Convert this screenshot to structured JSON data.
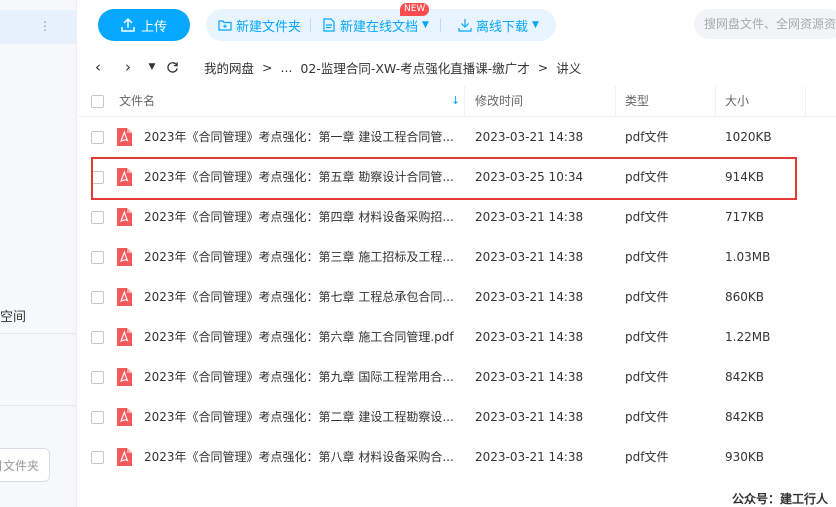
{
  "sidebar": {
    "space_label": "空间",
    "new_folder_label": "目文件夹"
  },
  "toolbar": {
    "upload_label": "上传",
    "new_folder_label": "新建文件夹",
    "new_online_doc_label": "新建在线文档",
    "new_badge": "NEW",
    "offline_download_label": "离线下载",
    "search_placeholder": "搜网盘文件、全网资源资"
  },
  "breadcrumb": {
    "items": [
      "我的网盘",
      "...",
      "02-监理合同-XW-考点强化直播课-缴广才",
      "讲义"
    ],
    "separator": ">"
  },
  "table": {
    "headers": {
      "name": "文件名",
      "modified": "修改时间",
      "type": "类型",
      "size": "大小"
    },
    "rows": [
      {
        "name": "2023年《合同管理》考点强化：第一章 建设工程合同管...",
        "modified": "2023-03-21 14:38",
        "type": "pdf文件",
        "size": "1020KB"
      },
      {
        "name": "2023年《合同管理》考点强化：第五章 勘察设计合同管...",
        "modified": "2023-03-25 10:34",
        "type": "pdf文件",
        "size": "914KB"
      },
      {
        "name": "2023年《合同管理》考点强化：第四章 材料设备采购招...",
        "modified": "2023-03-21 14:38",
        "type": "pdf文件",
        "size": "717KB"
      },
      {
        "name": "2023年《合同管理》考点强化：第三章 施工招标及工程...",
        "modified": "2023-03-21 14:38",
        "type": "pdf文件",
        "size": "1.03MB"
      },
      {
        "name": "2023年《合同管理》考点强化：第七章 工程总承包合同...",
        "modified": "2023-03-21 14:38",
        "type": "pdf文件",
        "size": "860KB"
      },
      {
        "name": "2023年《合同管理》考点强化：第六章 施工合同管理.pdf",
        "modified": "2023-03-21 14:38",
        "type": "pdf文件",
        "size": "1.22MB"
      },
      {
        "name": "2023年《合同管理》考点强化：第九章 国际工程常用合...",
        "modified": "2023-03-21 14:38",
        "type": "pdf文件",
        "size": "842KB"
      },
      {
        "name": "2023年《合同管理》考点强化：第二章 建设工程勘察设...",
        "modified": "2023-03-21 14:38",
        "type": "pdf文件",
        "size": "842KB"
      },
      {
        "name": "2023年《合同管理》考点强化：第八章 材料设备采购合...",
        "modified": "2023-03-21 14:38",
        "type": "pdf文件",
        "size": "930KB"
      }
    ]
  },
  "watermark": "公众号：建工行人",
  "colors": {
    "accent": "#06a7ff",
    "pdf_red": "#f25a5a",
    "highlight_border": "#e53935"
  }
}
